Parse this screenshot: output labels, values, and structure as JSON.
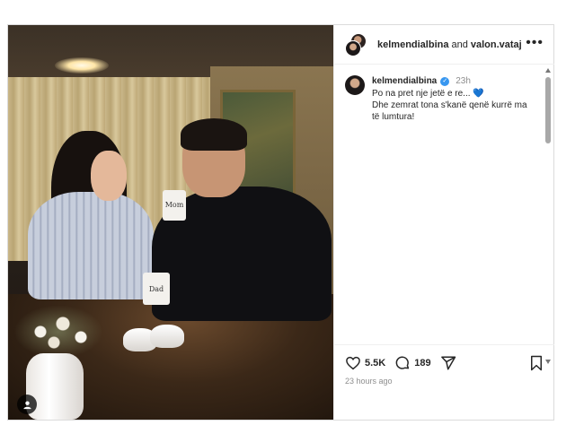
{
  "header": {
    "user1": "kelmendialbina",
    "and": "and",
    "user2": "valon.vataj",
    "more_icon": "more-horizontal-icon"
  },
  "post": {
    "photo_props": {
      "mug_left": "Mom",
      "mug_right": "Dad"
    },
    "caption": {
      "username": "kelmendialbina",
      "verified": true,
      "time": "23h",
      "line1": "Po na pret nje jetë e re...",
      "emoji": "💙",
      "line2": "Dhe zemrat tona s'kanë qenë kurrë ma\ntë lumtura!"
    }
  },
  "actions": {
    "likes": "5.5K",
    "comments": "189"
  },
  "timestamp": "23 hours ago",
  "colors": {
    "verified": "#3897f0",
    "muted": "#8e8e8e",
    "text": "#262626"
  }
}
